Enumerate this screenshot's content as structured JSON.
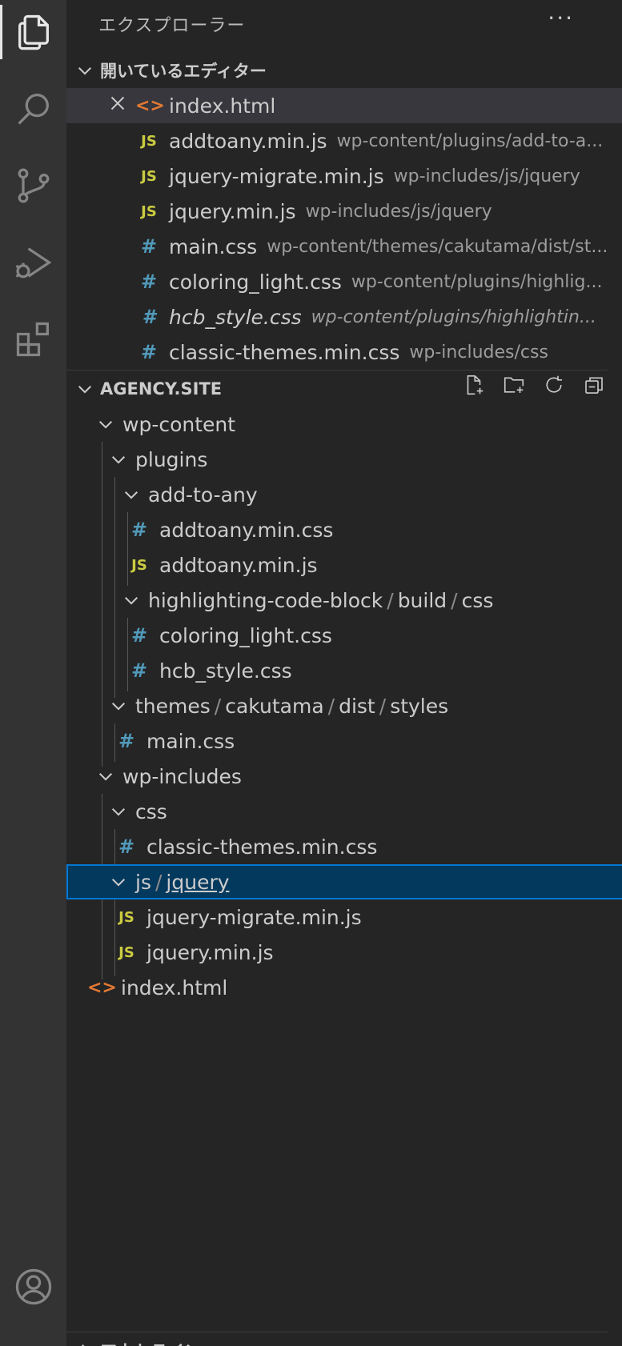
{
  "sidebar": {
    "title": "エクスプローラー",
    "more": "···"
  },
  "open_editors": {
    "heading": "開いているエディター",
    "items": [
      {
        "icon": "html",
        "glyph": "<>",
        "name": "index.html",
        "desc": ""
      },
      {
        "icon": "js",
        "glyph": "JS",
        "name": "addtoany.min.js",
        "desc": "wp-content/plugins/add-to-a..."
      },
      {
        "icon": "js",
        "glyph": "JS",
        "name": "jquery-migrate.min.js",
        "desc": "wp-includes/js/jquery"
      },
      {
        "icon": "js",
        "glyph": "JS",
        "name": "jquery.min.js",
        "desc": "wp-includes/js/jquery"
      },
      {
        "icon": "css",
        "glyph": "#",
        "name": "main.css",
        "desc": "wp-content/themes/cakutama/dist/st..."
      },
      {
        "icon": "css",
        "glyph": "#",
        "name": "coloring_light.css",
        "desc": "wp-content/plugins/highlig..."
      },
      {
        "icon": "css",
        "glyph": "#",
        "name": "hcb_style.css",
        "desc": "wp-content/plugins/highlightin..."
      },
      {
        "icon": "css",
        "glyph": "#",
        "name": "classic-themes.min.css",
        "desc": "wp-includes/css"
      }
    ]
  },
  "workspace": {
    "heading": "AGENCY.SITE",
    "tree": {
      "wp_content": "wp-content",
      "plugins": "plugins",
      "add_to_any": "add-to-any",
      "addtoany_css": "addtoany.min.css",
      "addtoany_js": "addtoany.min.js",
      "hcb": "highlighting-code-block",
      "build": "build",
      "css_folder": "css",
      "coloring_light": "coloring_light.css",
      "hcb_style": "hcb_style.css",
      "themes": "themes",
      "cakutama": "cakutama",
      "dist": "dist",
      "styles": "styles",
      "main_css": "main.css",
      "wp_includes": "wp-includes",
      "css": "css",
      "classic_themes": "classic-themes.min.css",
      "js": "js",
      "jquery": "jquery",
      "jquery_migrate": "jquery-migrate.min.js",
      "jquery_min": "jquery.min.js",
      "index_html": "index.html",
      "slash": "/"
    }
  },
  "outline": {
    "heading": "アウトライン"
  },
  "colors": {
    "js": "#cbcb41",
    "css": "#519aba",
    "html": "#e37933",
    "selection": "#04395e",
    "focus": "#0078d4"
  }
}
